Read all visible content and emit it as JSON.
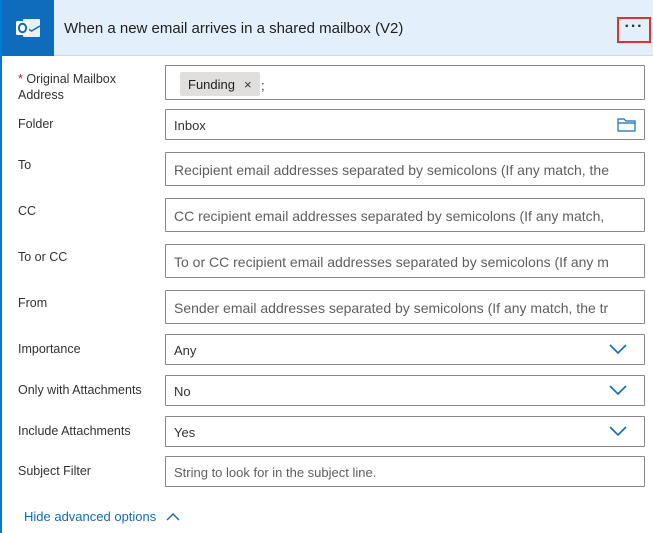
{
  "header": {
    "title": "When a new email arrives in a shared mailbox (V2)",
    "app_icon": "outlook-icon",
    "more_icon": "more-options-icon",
    "more_label": "···"
  },
  "fields": {
    "mailbox": {
      "required_mark": "*",
      "label": "Original Mailbox Address",
      "token": "Funding",
      "token_remove": "×",
      "separator": ";"
    },
    "folder": {
      "label": "Folder",
      "value": "Inbox",
      "icon": "folder-icon"
    },
    "to": {
      "label": "To",
      "placeholder": "Recipient email addresses separated by semicolons (If any match, the"
    },
    "cc": {
      "label": "CC",
      "placeholder": "CC recipient email addresses separated by semicolons (If any match, "
    },
    "to_or_cc": {
      "label": "To or CC",
      "placeholder": "To or CC recipient email addresses separated by semicolons (If any m"
    },
    "from": {
      "label": "From",
      "placeholder": "Sender email addresses separated by semicolons (If any match, the tr"
    },
    "importance": {
      "label": "Importance",
      "value": "Any"
    },
    "only_with_attachments": {
      "label": "Only with Attachments",
      "value": "No"
    },
    "include_attachments": {
      "label": "Include Attachments",
      "value": "Yes"
    },
    "subject_filter": {
      "label": "Subject Filter",
      "placeholder": "String to look for in the subject line."
    }
  },
  "footer": {
    "advanced_label": "Hide advanced options"
  },
  "colors": {
    "accent": "#0f6cbd",
    "header_bg": "#e3effa",
    "highlight": "#e03131"
  }
}
